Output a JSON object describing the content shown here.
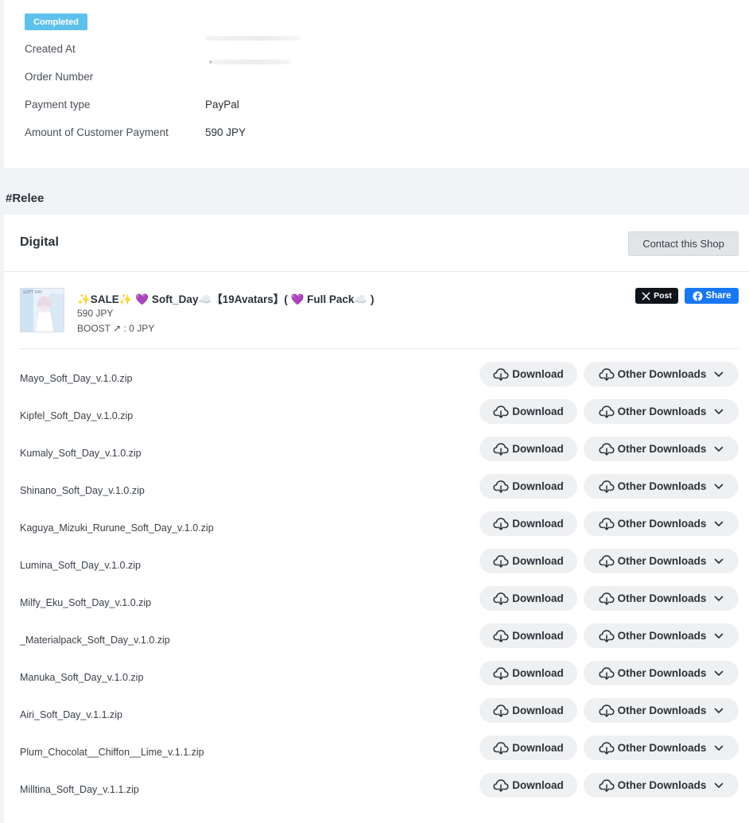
{
  "order": {
    "status_badge": "Completed",
    "rows": [
      {
        "label": "Created At",
        "value": ""
      },
      {
        "label": "Order Number",
        "value": ""
      },
      {
        "label": "Payment type",
        "value": "PayPal"
      },
      {
        "label": "Amount of Customer Payment",
        "value": "590 JPY"
      }
    ]
  },
  "shop": {
    "name": "#Relee",
    "section_title": "Digital",
    "contact_label": "Contact this Shop"
  },
  "product": {
    "title": "✨SALE✨ 💜 Soft_Day☁️【19Avatars】( 💜 Full Pack☁️ )",
    "price": "590 JPY",
    "boost": "BOOST ↗ : 0 JPY",
    "thumbnail_caption": "SOFT DAY",
    "x_post_label": "Post",
    "fb_share_label": "Share"
  },
  "files": [
    {
      "name": "Mayo_Soft_Day_v.1.0.zip"
    },
    {
      "name": "Kipfel_Soft_Day_v.1.0.zip"
    },
    {
      "name": "Kumaly_Soft_Day_v.1.0.zip"
    },
    {
      "name": "Shinano_Soft_Day_v.1.0.zip"
    },
    {
      "name": "Kaguya_Mizuki_Rurune_Soft_Day_v.1.0.zip"
    },
    {
      "name": "Lumina_Soft_Day_v.1.0.zip"
    },
    {
      "name": "Milfy_Eku_Soft_Day_v.1.0.zip"
    },
    {
      "name": "_Materialpack_Soft_Day_v.1.0.zip"
    },
    {
      "name": "Manuka_Soft_Day_v.1.0.zip"
    },
    {
      "name": "Airi_Soft_Day_v.1.1.zip"
    },
    {
      "name": "Plum_Chocolat__Chiffon__Lime_v.1.1.zip"
    },
    {
      "name": "Milltina_Soft_Day_v.1.1.zip"
    }
  ],
  "buttons": {
    "download_label": "Download",
    "other_downloads_label": "Other Downloads"
  },
  "icons": {
    "download": "cloud-download-icon",
    "dropdown": "chevron-down-icon",
    "x": "x-logo-icon",
    "facebook": "facebook-icon"
  },
  "colors": {
    "badge": "#5ec0ec",
    "facebook": "#1877f2",
    "x": "#0f1419",
    "button_bg": "#eff0f2",
    "page_bg": "#f1f4f7"
  }
}
